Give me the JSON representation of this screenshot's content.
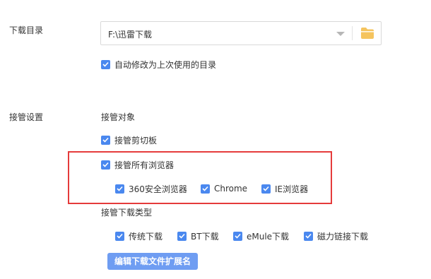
{
  "download_dir": {
    "label": "下载目录",
    "path": "F:\\迅雷下载",
    "dropdown_icon": "chevron-down-icon",
    "folder_icon": "folder-icon",
    "auto_modify": {
      "label": "自动修改为上次使用的目录",
      "checked": true
    }
  },
  "takeover": {
    "label": "接管设置",
    "target_label": "接管对象",
    "clipboard": {
      "label": "接管剪切板",
      "checked": true
    },
    "all_browsers": {
      "label": "接管所有浏览器",
      "checked": true
    },
    "browsers": [
      {
        "label": "360安全浏览器",
        "checked": true
      },
      {
        "label": "Chrome",
        "checked": true
      },
      {
        "label": "IE浏览器",
        "checked": true
      }
    ],
    "types_label": "接管下载类型",
    "types": [
      {
        "label": "传统下载",
        "checked": true
      },
      {
        "label": "BT下载",
        "checked": true
      },
      {
        "label": "eMule下载",
        "checked": true
      },
      {
        "label": "磁力链接下载",
        "checked": true
      }
    ],
    "edit_ext_button": "编辑下载文件扩展名"
  },
  "colors": {
    "checkbox": "#4a88ef",
    "button": "#6f9df2",
    "highlight_border": "#e53b3b",
    "folder": "#f5c45e"
  }
}
